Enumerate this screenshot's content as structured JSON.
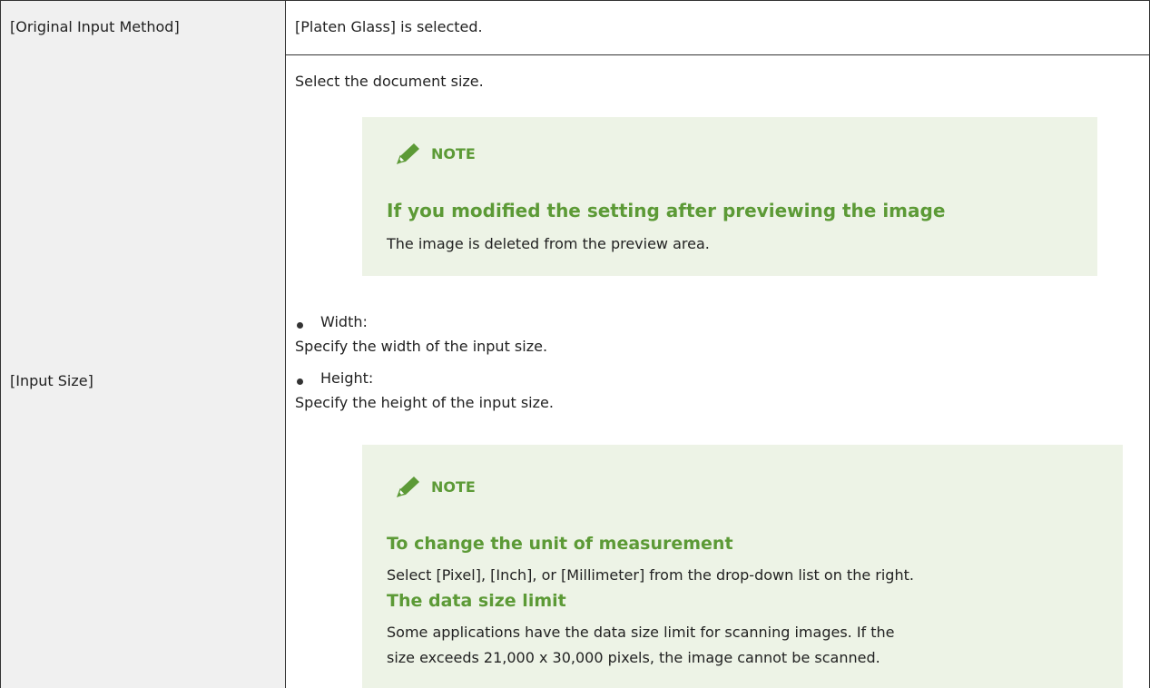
{
  "rows": [
    {
      "label": "[Original Input Method]",
      "value": "[Platen Glass] is selected."
    },
    {
      "label": "[Input Size]",
      "intro": "Select the document size.",
      "note1": {
        "heading": "NOTE",
        "icon": "pencil-icon",
        "title": "If you modified the setting after previewing the image",
        "body": "The image is deleted from the preview area."
      },
      "bullets": [
        {
          "term": "Width:",
          "desc": "Specify the width of the input size."
        },
        {
          "term": "Height:",
          "desc": "Specify the height of the input size."
        }
      ],
      "note2": {
        "heading": "NOTE",
        "icon": "pencil-icon",
        "items": [
          {
            "title": "To change the unit of measurement",
            "body": "Select [Pixel], [Inch], or [Millimeter] from the drop-down list on the right."
          },
          {
            "title": "The data size limit",
            "body_line1": "Some applications have the data size limit for scanning images. If the",
            "body_line2": "size exceeds 21,000 x 30,000 pixels, the image cannot be scanned."
          }
        ]
      }
    }
  ],
  "colors": {
    "label_bg": "#f0f0f0",
    "note_bg": "#edf3e6",
    "note_accent": "#5c9a36",
    "border": "#333333"
  }
}
